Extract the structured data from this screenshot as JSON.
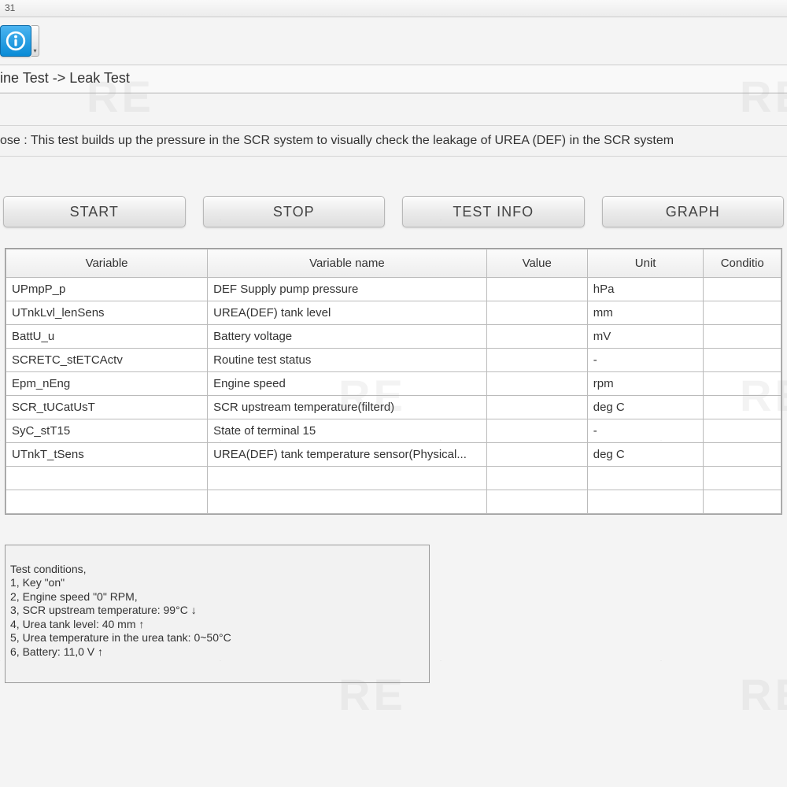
{
  "titlebar": "31",
  "breadcrumb": "ine Test -> Leak Test",
  "purpose": "ose : This test builds up the pressure in the SCR system to visually check the leakage of UREA (DEF) in the SCR system",
  "buttons": {
    "start": "START",
    "stop": "STOP",
    "test_info": "TEST INFO",
    "graph": "GRAPH"
  },
  "table": {
    "headers": {
      "variable": "Variable",
      "variable_name": "Variable name",
      "value": "Value",
      "unit": "Unit",
      "condition": "Conditio"
    },
    "rows": [
      {
        "variable": "UPmpP_p",
        "name": "DEF Supply pump pressure",
        "value": "",
        "unit": "hPa",
        "condition": ""
      },
      {
        "variable": "UTnkLvl_lenSens",
        "name": "UREA(DEF) tank level",
        "value": "",
        "unit": "mm",
        "condition": ""
      },
      {
        "variable": "BattU_u",
        "name": "Battery voltage",
        "value": "",
        "unit": "mV",
        "condition": ""
      },
      {
        "variable": "SCRETC_stETCActv",
        "name": "Routine test status",
        "value": "",
        "unit": "-",
        "condition": ""
      },
      {
        "variable": "Epm_nEng",
        "name": "Engine speed",
        "value": "",
        "unit": "rpm",
        "condition": ""
      },
      {
        "variable": "SCR_tUCatUsT",
        "name": "SCR upstream temperature(filterd)",
        "value": "",
        "unit": "deg C",
        "condition": ""
      },
      {
        "variable": "SyC_stT15",
        "name": "State of terminal 15",
        "value": "",
        "unit": "-",
        "condition": ""
      },
      {
        "variable": "UTnkT_tSens",
        "name": "UREA(DEF) tank temperature sensor(Physical...",
        "value": "",
        "unit": "deg C",
        "condition": ""
      },
      {
        "variable": "",
        "name": "",
        "value": "",
        "unit": "",
        "condition": ""
      },
      {
        "variable": "",
        "name": "",
        "value": "",
        "unit": "",
        "condition": ""
      }
    ]
  },
  "test_conditions": "Test conditions,\n1, Key \"on\"\n2, Engine speed \"0\" RPM,\n3, SCR upstream temperature: 99°C ↓\n4, Urea tank level: 40 mm ↑\n5, Urea temperature in the urea tank: 0~50°C\n6, Battery: 11,0 V ↑",
  "watermark_text": "RE"
}
